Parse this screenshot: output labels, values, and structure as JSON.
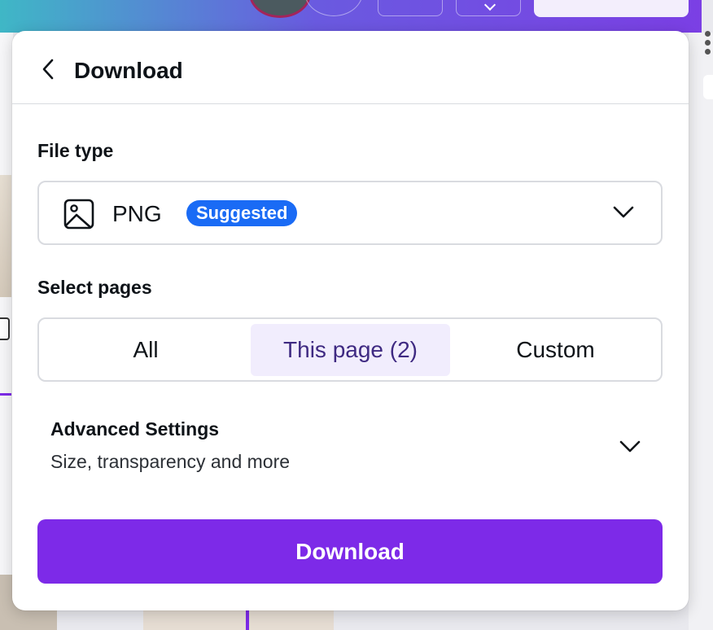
{
  "panel": {
    "title": "Download",
    "back_icon": "chevron-left-icon"
  },
  "file_type": {
    "label": "File type",
    "icon": "image-icon",
    "value": "PNG",
    "badge": "Suggested",
    "badge_color": "#1a6bf5",
    "dropdown_icon": "chevron-down-icon"
  },
  "select_pages": {
    "label": "Select pages",
    "options": [
      "All",
      "This page (2)",
      "Custom"
    ],
    "selected": "This page (2)"
  },
  "advanced": {
    "title": "Advanced Settings",
    "subtitle": "Size, transparency and more",
    "expand_icon": "chevron-down-icon"
  },
  "download_button": {
    "label": "Download",
    "color": "#7d2ae8"
  }
}
